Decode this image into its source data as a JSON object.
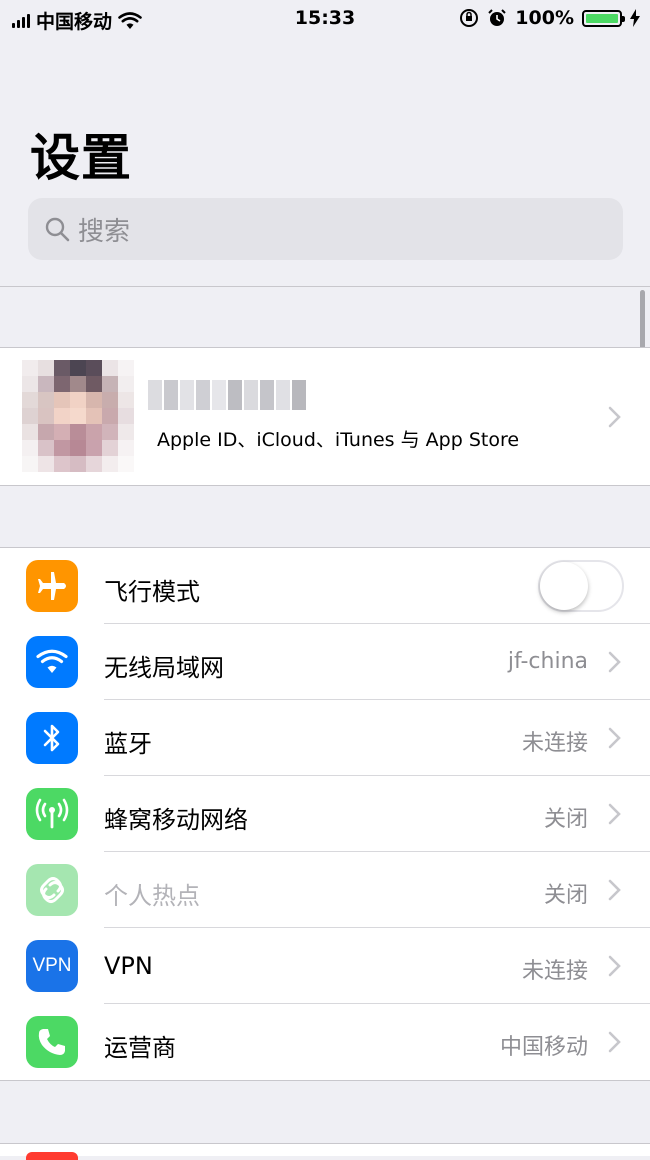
{
  "status_bar": {
    "carrier": "中国移动",
    "time": "15:33",
    "battery": "100%"
  },
  "page_title": "设置",
  "search": {
    "placeholder": "搜索"
  },
  "profile": {
    "subtitle": "Apple ID、iCloud、iTunes 与 App Store"
  },
  "settings": [
    {
      "label": "飞行模式",
      "icon": "airplane-icon",
      "color": "#ff9500",
      "toggle": false
    },
    {
      "label": "无线局域网",
      "icon": "wifi-icon",
      "color": "#007aff",
      "value": "jf-china"
    },
    {
      "label": "蓝牙",
      "icon": "bluetooth-icon",
      "color": "#007aff",
      "value": "未连接"
    },
    {
      "label": "蜂窝移动网络",
      "icon": "cellular-icon",
      "color": "#4cd964",
      "value": "关闭"
    },
    {
      "label": "个人热点",
      "icon": "hotspot-icon",
      "color": "#a5e6b0",
      "value": "关闭",
      "disabled": true
    },
    {
      "label": "VPN",
      "icon": "vpn-icon",
      "icon_text": "VPN",
      "color": "#1a73e8",
      "value": "未连接"
    },
    {
      "label": "运营商",
      "icon": "phone-icon",
      "color": "#4cd964",
      "value": "中国移动"
    }
  ]
}
